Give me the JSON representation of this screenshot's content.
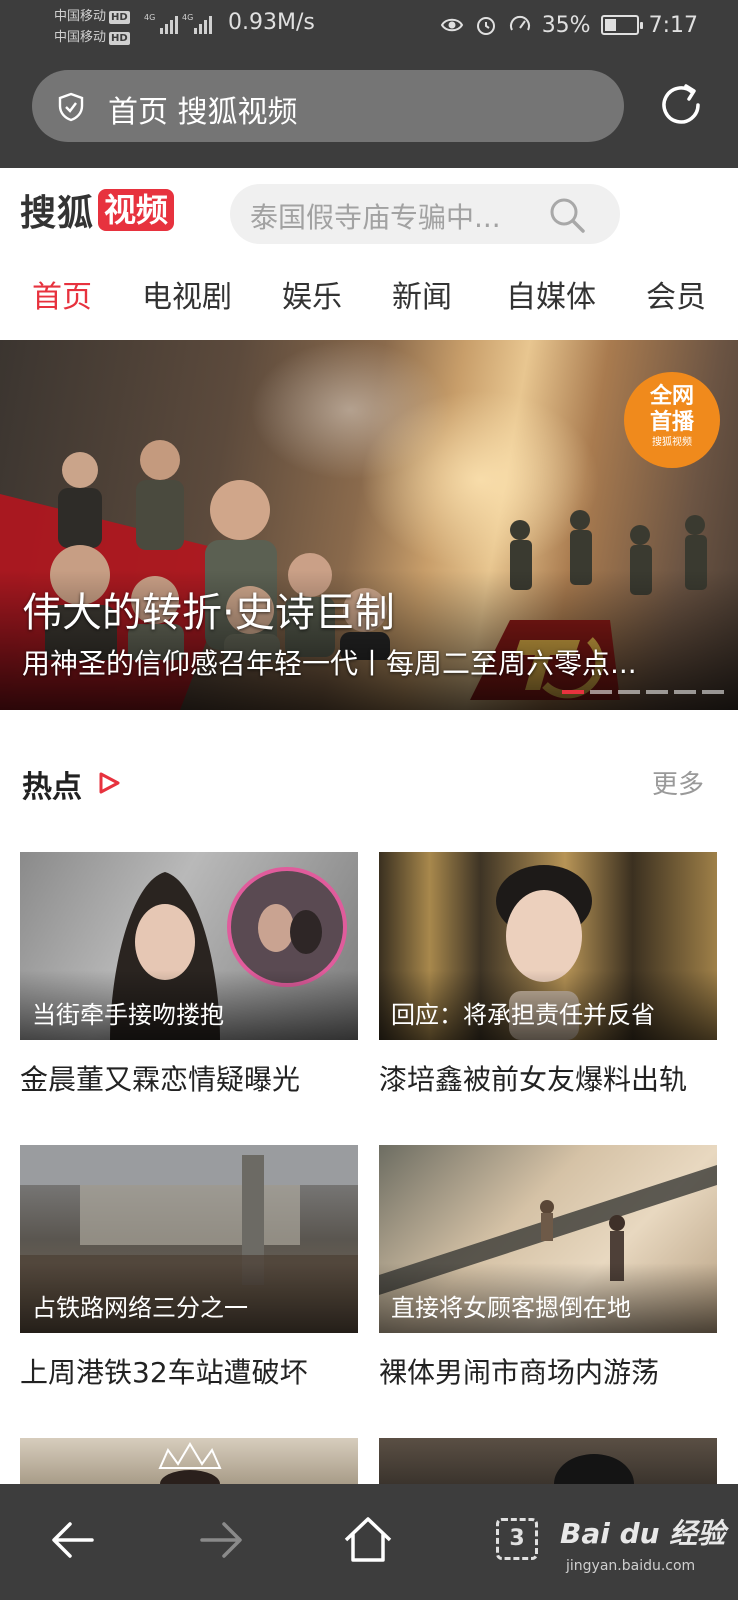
{
  "status_bar": {
    "carrier_1": "中国移动",
    "carrier_2": "中国移动",
    "hd_badge": "HD",
    "network": "4G",
    "speed": "0.93M/s",
    "battery": "35%",
    "battery_level": 0.35,
    "time": "7:17"
  },
  "browser": {
    "url_text": "首页 搜狐视频"
  },
  "site": {
    "logo_part1": "搜狐",
    "logo_part2": "视频",
    "search_placeholder": "泰国假寺庙专骗中..."
  },
  "tabs": [
    {
      "label": "首页",
      "active": true
    },
    {
      "label": "电视剧",
      "active": false
    },
    {
      "label": "娱乐",
      "active": false
    },
    {
      "label": "新闻",
      "active": false
    },
    {
      "label": "自媒体",
      "active": false
    },
    {
      "label": "会员",
      "active": false
    }
  ],
  "banner": {
    "title": "伟大的转折·史诗巨制",
    "subtitle": "用神圣的信仰感召年轻一代丨每周二至周六零点...",
    "badge_line1": "全网",
    "badge_line2": "首播",
    "badge_line3": "搜狐视频",
    "slide_count": 6,
    "active_slide": 1
  },
  "hot_section": {
    "title": "热点",
    "more": "更多"
  },
  "cards": [
    {
      "caption": "当街牵手接吻搂抱",
      "title": "金晨董又霖恋情疑曝光"
    },
    {
      "caption": "回应：将承担责任并反省",
      "title": "漆培鑫被前女友爆料出轨"
    },
    {
      "caption": "占铁路网络三分之一",
      "title": "上周港铁32车站遭破坏"
    },
    {
      "caption": "直接将女顾客摁倒在地",
      "title": "裸体男闹市商场内游荡"
    }
  ],
  "bottom_nav": {
    "tab_count": "3"
  },
  "watermark": {
    "brand": "Bai du 经验",
    "url": "jingyan.baidu.com"
  },
  "colors": {
    "accent": "#e7323e",
    "bar_bg": "#3d3d3d"
  }
}
